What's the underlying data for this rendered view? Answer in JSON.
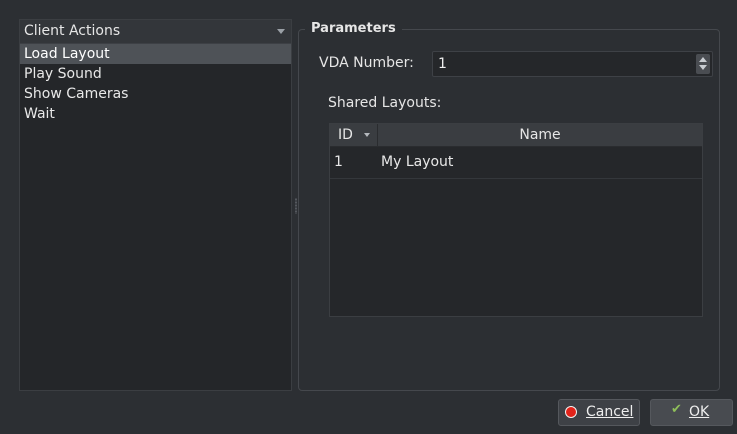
{
  "left_pane": {
    "combo_label": "Client Actions",
    "actions": [
      {
        "label": "Load Layout"
      },
      {
        "label": "Play Sound"
      },
      {
        "label": "Show Cameras"
      },
      {
        "label": "Wait"
      }
    ],
    "selected_index": 0
  },
  "parameters": {
    "title": "Parameters",
    "vda_label": "VDA Number:",
    "vda_value": "1",
    "shared_label": "Shared Layouts:",
    "table": {
      "headers": {
        "id": "ID",
        "name": "Name"
      },
      "rows": [
        {
          "id": "1",
          "name": "My Layout"
        }
      ]
    }
  },
  "buttons": {
    "cancel": "Cancel",
    "ok": "OK"
  },
  "colors": {
    "background": "#2c2f33",
    "selection": "#4e5257",
    "cancel_icon": "#e2231a",
    "ok_icon": "#8fbf5a"
  },
  "icons": {
    "combo": "chevron-down-icon",
    "sort": "sort-desc-icon",
    "cancel": "stop-icon",
    "ok": "check-icon"
  }
}
